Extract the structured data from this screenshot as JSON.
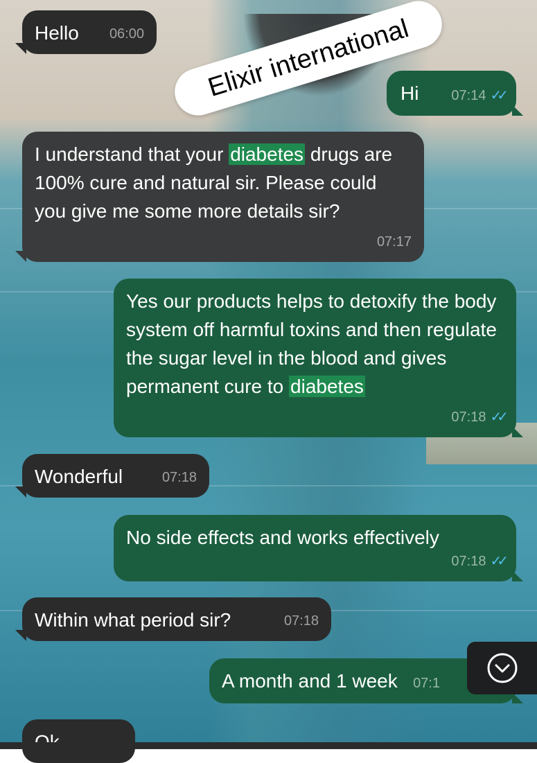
{
  "watermark": "Elixir international",
  "messages": [
    {
      "direction": "incoming",
      "text": "Hello",
      "time": "06:00"
    },
    {
      "direction": "outgoing",
      "text": "Hi",
      "time": "07:14",
      "read": true
    },
    {
      "direction": "incoming",
      "text_before": "I understand that your ",
      "highlight": "diabetes",
      "text_after": " drugs are 100% cure and natural sir. Please could you give me some more details sir?",
      "time": "07:17"
    },
    {
      "direction": "outgoing",
      "text_before": "Yes our products helps to detoxify the body system off harmful toxins and then regulate the sugar level in the blood and gives permanent cure to ",
      "highlight": "diabetes",
      "time": "07:18",
      "read": true
    },
    {
      "direction": "incoming",
      "text": "Wonderful",
      "time": "07:18"
    },
    {
      "direction": "outgoing",
      "text": "No side effects and works effectively",
      "time": "07:18",
      "read": true
    },
    {
      "direction": "incoming",
      "text": "Within what period sir?",
      "time": "07:18"
    },
    {
      "direction": "outgoing",
      "text": "A month and 1 week",
      "time": "07:1",
      "read": true
    },
    {
      "direction": "incoming",
      "text": "Ok",
      "time": ""
    }
  ],
  "icons": {
    "scroll_down": "chevron-down-circle-icon",
    "read_receipt": "double-check-icon"
  },
  "colors": {
    "incoming_bubble": "#2b2b2b",
    "outgoing_bubble": "#1b5e3f",
    "highlight": "#1f8a4f",
    "read_ticks": "#53bdeb"
  }
}
